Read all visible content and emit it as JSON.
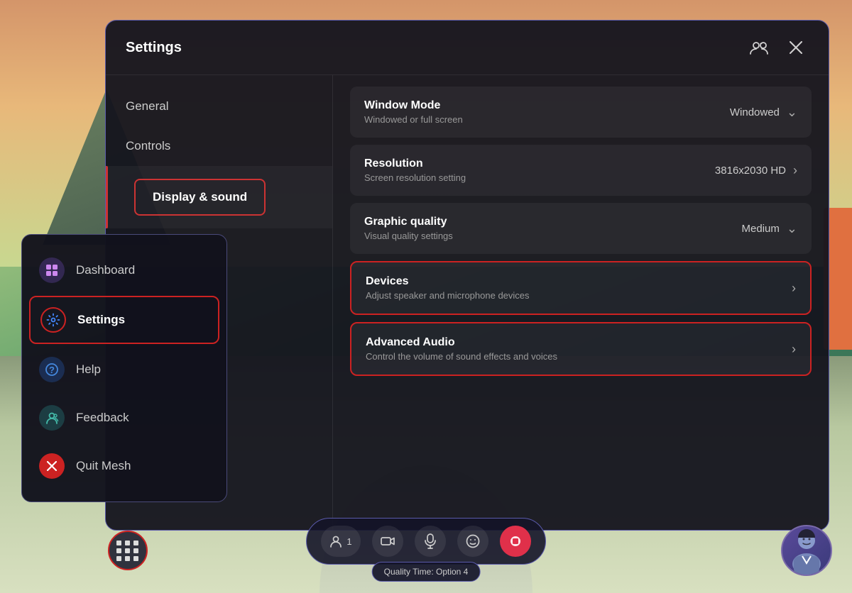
{
  "app": {
    "title": "Settings"
  },
  "background": {
    "quality_pill": "Quality Time: Option 4"
  },
  "settings_nav": {
    "items": [
      {
        "id": "general",
        "label": "General",
        "active": false
      },
      {
        "id": "controls",
        "label": "Controls",
        "active": false
      },
      {
        "id": "display-sound",
        "label": "Display & sound",
        "active": true
      }
    ]
  },
  "settings_rows": [
    {
      "id": "window-mode",
      "title": "Window Mode",
      "subtitle": "Windowed or full screen",
      "value": "Windowed",
      "type": "dropdown",
      "bordered": false
    },
    {
      "id": "resolution",
      "title": "Resolution",
      "subtitle": "Screen resolution setting",
      "value": "3816x2030 HD",
      "type": "arrow",
      "bordered": false
    },
    {
      "id": "graphic-quality",
      "title": "Graphic quality",
      "subtitle": "Visual quality settings",
      "value": "Medium",
      "type": "dropdown",
      "bordered": false
    },
    {
      "id": "devices",
      "title": "Devices",
      "subtitle": "Adjust speaker and microphone devices",
      "value": "",
      "type": "arrow",
      "bordered": true
    },
    {
      "id": "advanced-audio",
      "title": "Advanced Audio",
      "subtitle": "Control the volume of sound effects and voices",
      "value": "",
      "type": "arrow",
      "bordered": true
    }
  ],
  "side_menu": {
    "items": [
      {
        "id": "dashboard",
        "label": "Dashboard",
        "icon": "⬛",
        "icon_type": "purple"
      },
      {
        "id": "settings",
        "label": "Settings",
        "icon": "⚙",
        "icon_type": "settings-active",
        "active": true
      },
      {
        "id": "help",
        "label": "Help",
        "icon": "?",
        "icon_type": "blue"
      },
      {
        "id": "feedback",
        "label": "Feedback",
        "icon": "👤",
        "icon_type": "teal"
      },
      {
        "id": "quit-mesh",
        "label": "Quit Mesh",
        "icon": "✕",
        "icon_type": "red"
      }
    ]
  },
  "taskbar": {
    "buttons": [
      {
        "id": "people",
        "icon": "👤",
        "label": "People",
        "count": "1",
        "active": false
      },
      {
        "id": "camera",
        "icon": "📷",
        "label": "Camera",
        "active": false
      },
      {
        "id": "mic",
        "icon": "🎤",
        "label": "Microphone",
        "active": false
      },
      {
        "id": "emoji",
        "icon": "😊",
        "label": "Emoji",
        "active": false
      },
      {
        "id": "record",
        "icon": "⏺",
        "label": "Record",
        "active": true
      }
    ],
    "quality_pill": "Quality Time: Option 4"
  },
  "icons": {
    "close": "✕",
    "avatar": "👤",
    "chevron_right": "›",
    "chevron_down": "⌄",
    "apps": "⊞",
    "people_link": "🔗"
  }
}
